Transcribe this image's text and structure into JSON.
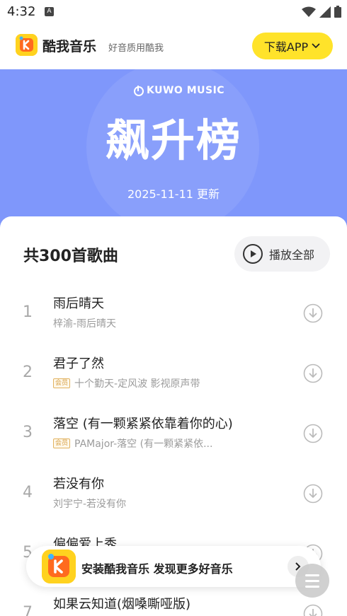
{
  "status_bar": {
    "time": "4:32",
    "notification_icon": "a-icon"
  },
  "header": {
    "app_name": "酷我音乐",
    "slogan": "好音质用酷我",
    "download_label": "下载APP"
  },
  "hero": {
    "brand": "KUWO MUSIC",
    "title": "飙升榜",
    "date": "2025-11-11 更新"
  },
  "list": {
    "total": "共300首歌曲",
    "play_all": "播放全部",
    "songs": [
      {
        "rank": "1",
        "title": "雨后晴天",
        "vip": false,
        "vip_label": "",
        "artist": "梓渝-雨后晴天"
      },
      {
        "rank": "2",
        "title": "君子了然",
        "vip": true,
        "vip_label": "会员",
        "artist": "十个勤天-定风波 影视原声带"
      },
      {
        "rank": "3",
        "title": "落空 (有一颗紧紧依靠着你的心)",
        "vip": true,
        "vip_label": "会员",
        "artist": "PAMajor-落空 (有一颗紧紧依..."
      },
      {
        "rank": "4",
        "title": "若没有你",
        "vip": false,
        "vip_label": "",
        "artist": "刘宇宁-若没有你"
      },
      {
        "rank": "5",
        "title": "偏偏爱上秀",
        "vip": false,
        "vip_label": "",
        "artist": ""
      },
      {
        "rank": "7",
        "title": "如果云知道(烟嗓嘶哑版)",
        "vip": false,
        "vip_label": "",
        "artist": ""
      }
    ]
  },
  "install_banner": {
    "text": "安装酷我音乐 发现更多好音乐"
  },
  "colors": {
    "accent_yellow": "#ffe32a",
    "hero_blue": "#7f97fb",
    "vip_gold": "#d6a24a"
  }
}
